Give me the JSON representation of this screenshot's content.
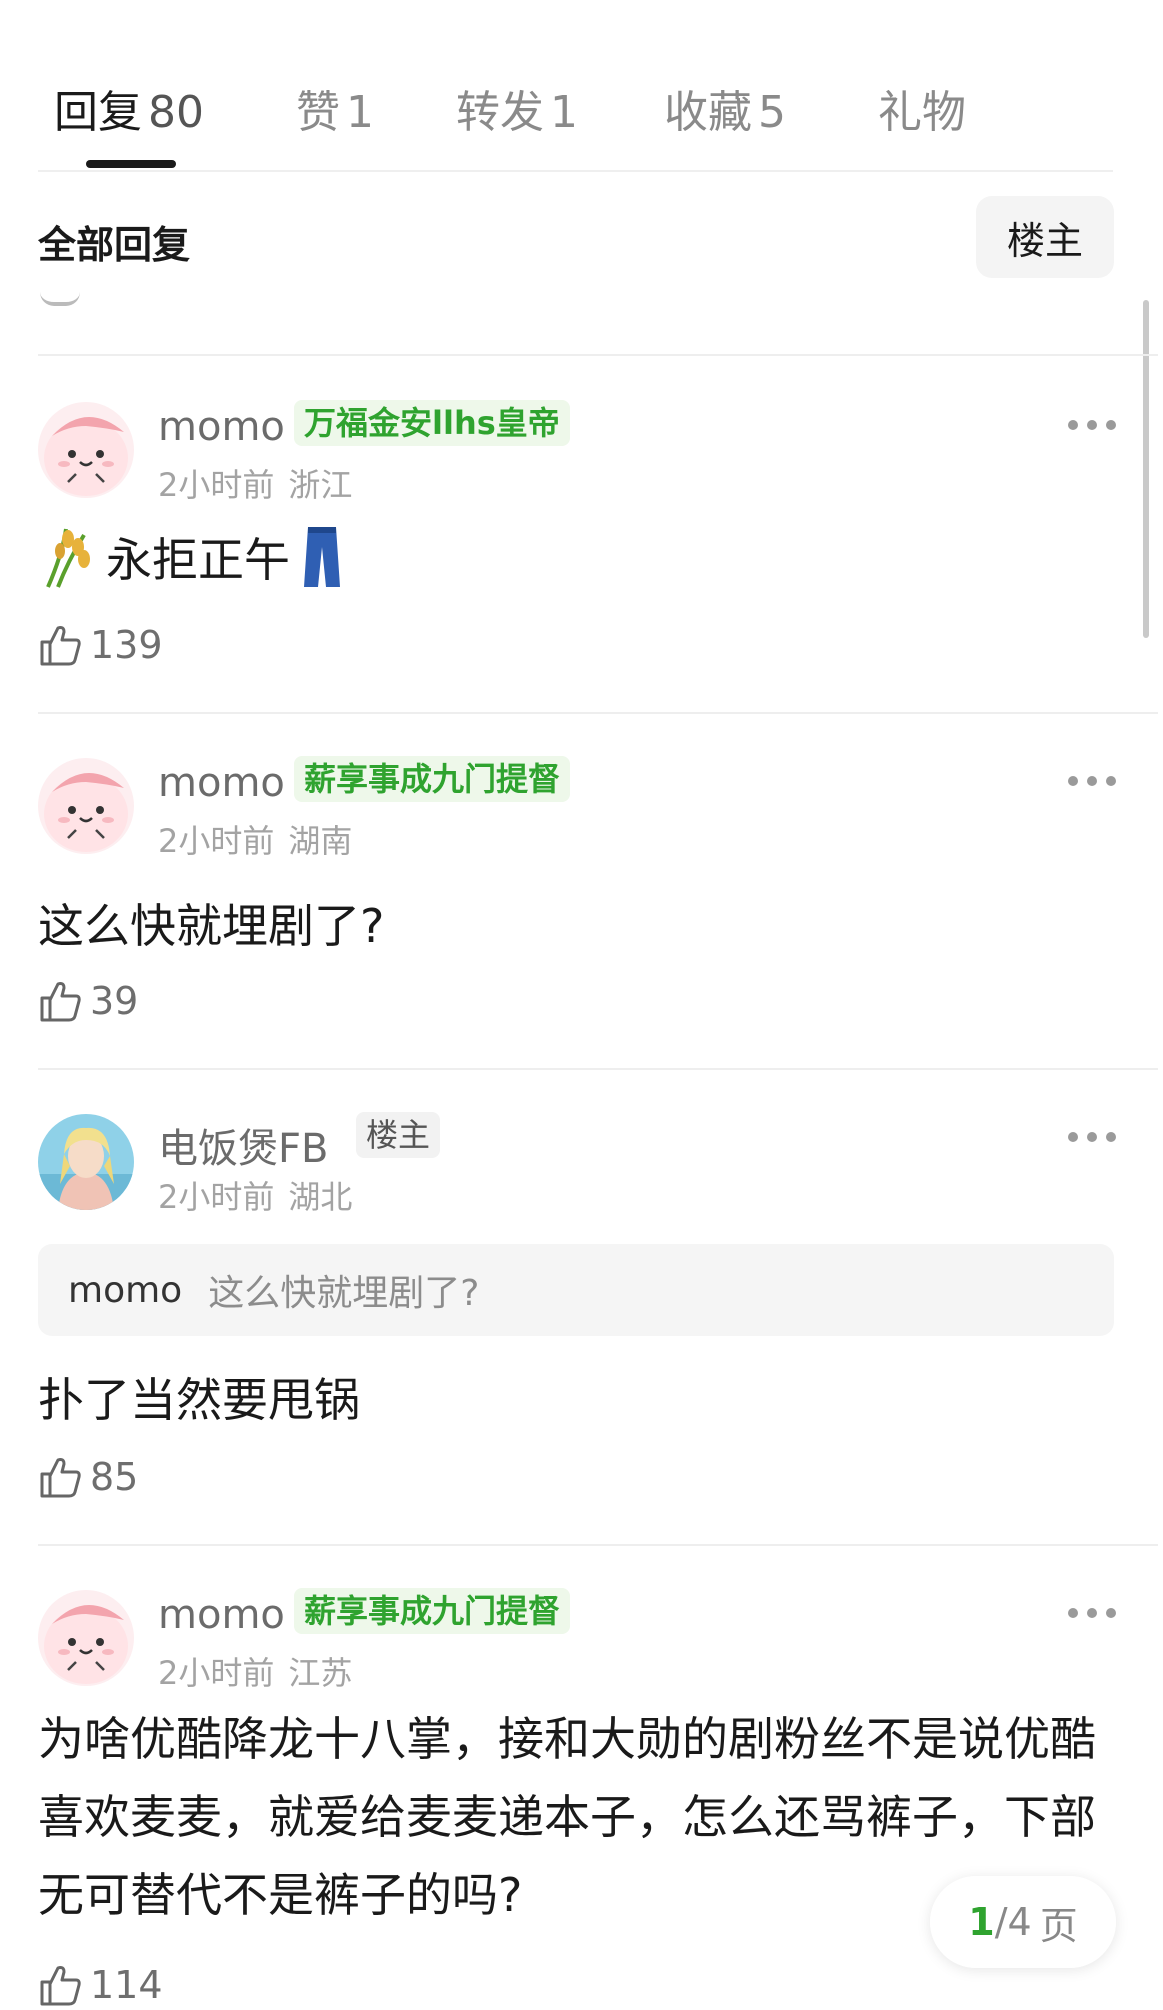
{
  "tabs": [
    {
      "label": "回复",
      "count": "80"
    },
    {
      "label": "赞",
      "count": "1"
    },
    {
      "label": "转发",
      "count": "1"
    },
    {
      "label": "收藏",
      "count": "5"
    },
    {
      "label": "礼物",
      "count": ""
    }
  ],
  "filter": {
    "title": "全部回复",
    "owner_button": "楼主"
  },
  "comments": [
    {
      "user": "momo",
      "badge": "万福金安llhs皇帝",
      "time": "2小时前",
      "location": "浙江",
      "text": "永拒正午",
      "emoji_before": "rice-ear",
      "emoji_after": "jeans",
      "likes": "139"
    },
    {
      "user": "momo",
      "badge": "薪享事成九门提督",
      "time": "2小时前",
      "location": "湖南",
      "text": "这么快就埋剧了?",
      "likes": "39"
    },
    {
      "user": "电饭煲FB",
      "badge": "楼主",
      "time": "2小时前",
      "location": "湖北",
      "quote_user": "momo",
      "quote_text": "这么快就埋剧了?",
      "text": "扑了当然要甩锅",
      "likes": "85"
    },
    {
      "user": "momo",
      "badge": "薪享事成九门提督",
      "time": "2小时前",
      "location": "江苏",
      "text": "为啥优酷降龙十八掌，接和大勋的剧粉丝不是说优酷喜欢麦麦，就爱给麦麦递本子，怎么还骂裤子，下部无可替代不是裤子的吗?",
      "likes": "114"
    }
  ],
  "pager": {
    "current": "1",
    "total": "/4",
    "unit": "页"
  },
  "colors": {
    "badge_green": "#2fa32f",
    "badge_bg": "#eef8ea",
    "page_current": "#2fa32f"
  }
}
